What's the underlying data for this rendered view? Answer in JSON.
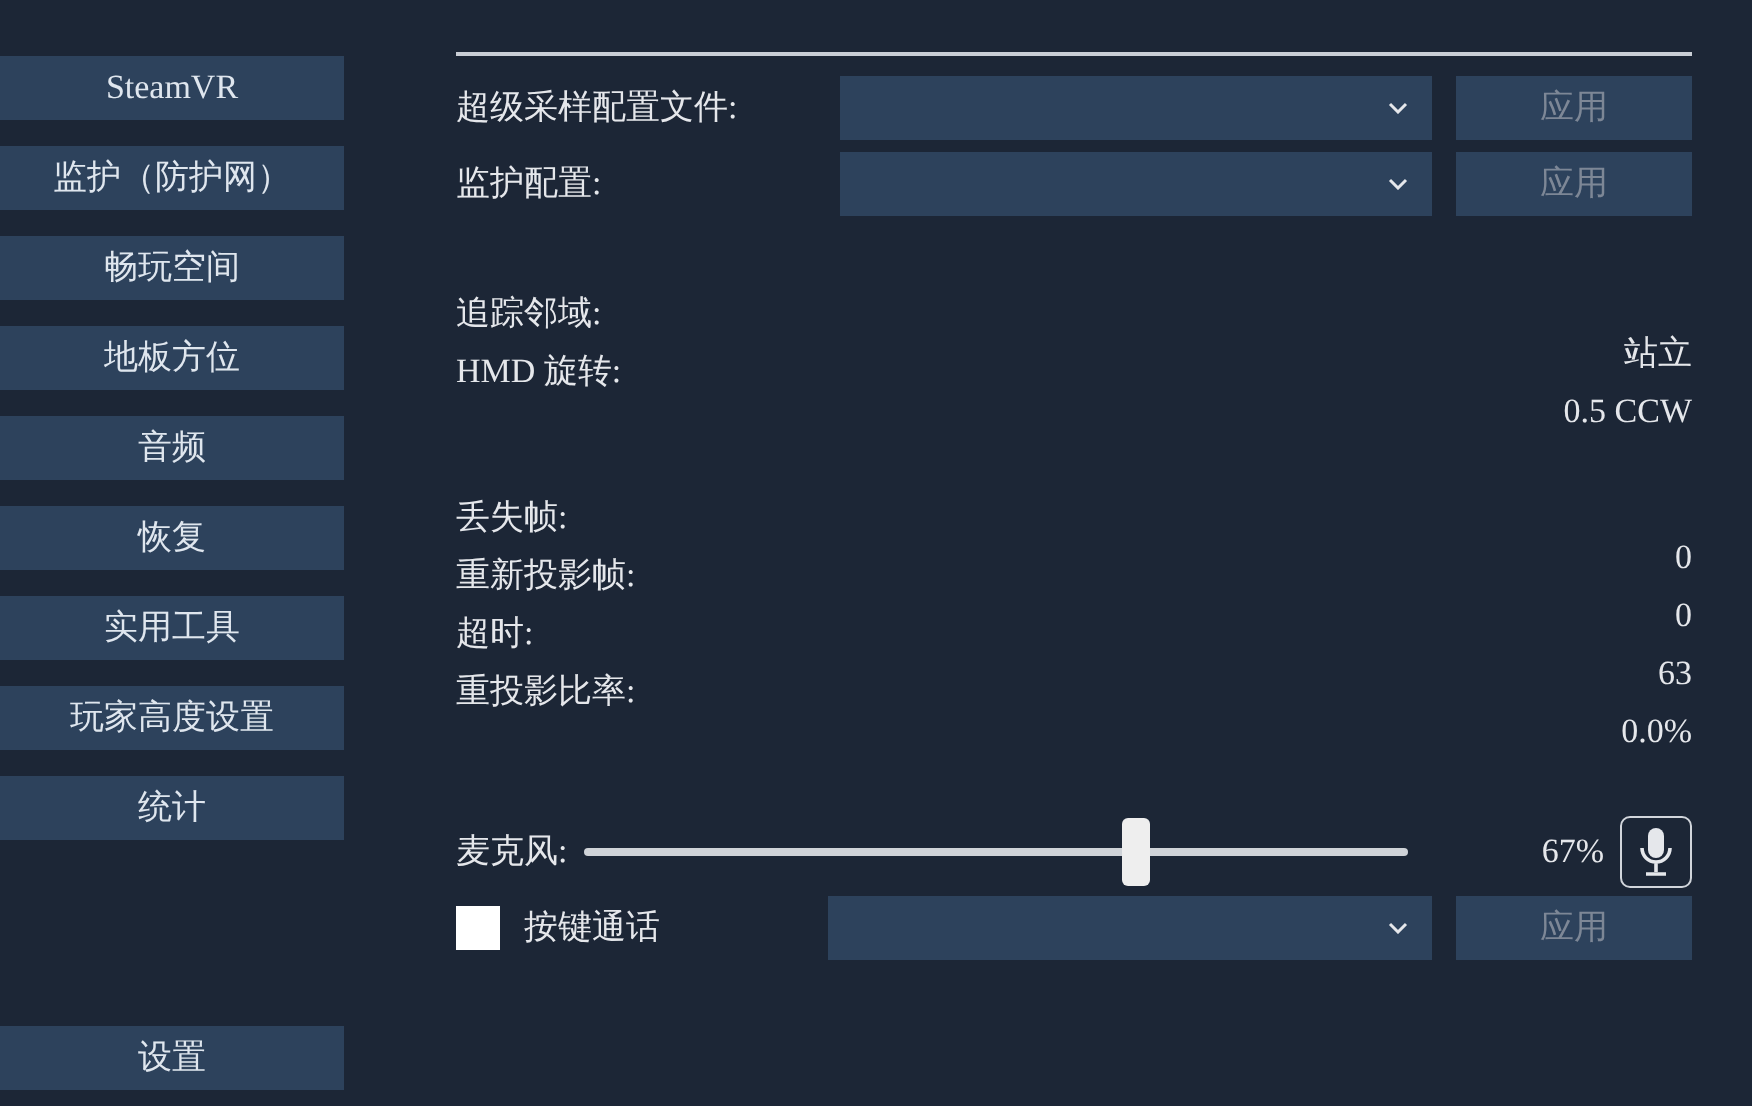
{
  "sidebar": {
    "items": [
      {
        "label": "SteamVR",
        "selected": false
      },
      {
        "label": "监护（防护网）",
        "selected": false
      },
      {
        "label": "畅玩空间",
        "selected": false
      },
      {
        "label": "地板方位",
        "selected": false
      },
      {
        "label": "音频",
        "selected": false
      },
      {
        "label": "恢复",
        "selected": false
      },
      {
        "label": "实用工具",
        "selected": false
      },
      {
        "label": "玩家高度设置",
        "selected": false
      },
      {
        "label": "统计",
        "selected": false
      }
    ],
    "bottom_items": [
      {
        "label": "设置",
        "selected": false
      }
    ]
  },
  "config_rows": [
    {
      "label": "超级采样配置文件:",
      "button": {
        "label": "应用",
        "disabled": true
      }
    },
    {
      "label": "监护配置:",
      "button": {
        "label": "应用",
        "disabled": true
      }
    }
  ],
  "stat_groups": [
    {
      "labels": [
        "追踪邻域:",
        "HMD 旋转:"
      ],
      "values": [
        "站立",
        "0.5 CCW"
      ]
    },
    {
      "labels": [
        "丢失帧:",
        "重新投影帧:",
        "超时:",
        "重投影比率:"
      ],
      "values": [
        "0",
        "0",
        "63",
        "0.0%"
      ]
    }
  ],
  "microphone": {
    "label": "麦克风:",
    "level": 0.67,
    "reading": "67%"
  },
  "push_to_talk": {
    "label": "按键通话",
    "checked": false,
    "button": {
      "label": "应用",
      "disabled": true
    }
  }
}
